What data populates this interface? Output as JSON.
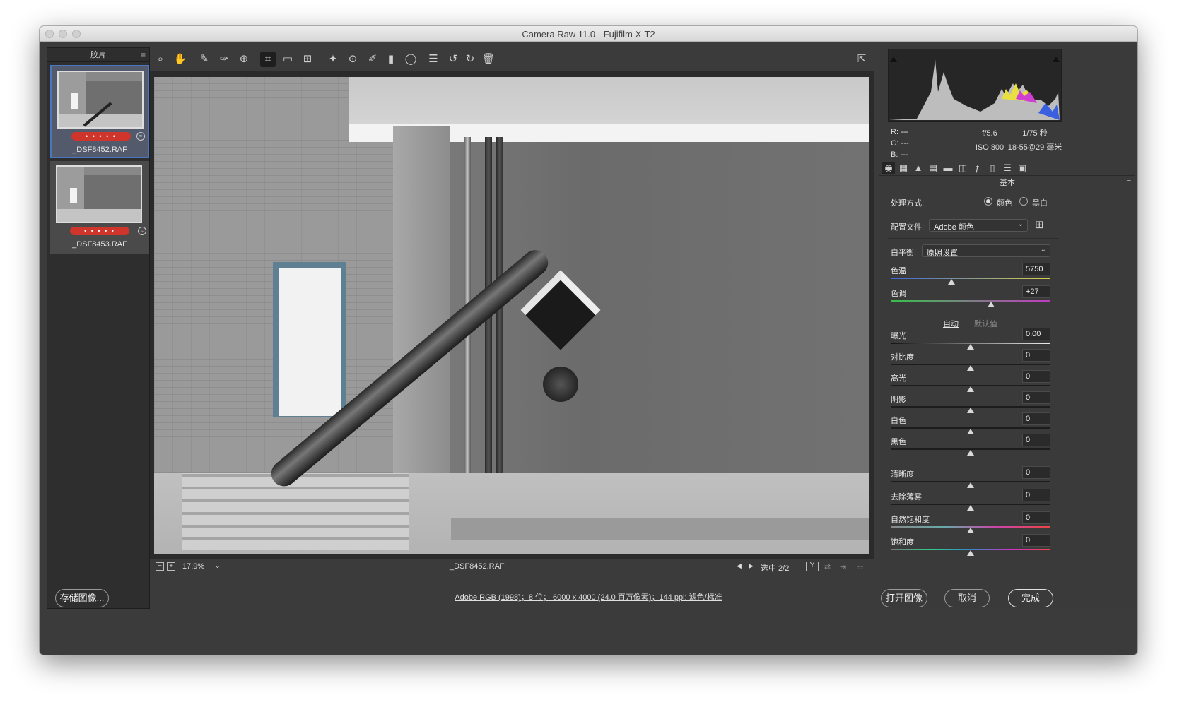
{
  "window": {
    "title": "Camera Raw 11.0 -  Fujifilm X-T2"
  },
  "filmstrip": {
    "title": "胶片",
    "items": [
      {
        "name": "_DSF8452.RAF",
        "rating": "• • • • •",
        "selected": true
      },
      {
        "name": "_DSF8453.RAF",
        "rating": "• • • • •",
        "selected": false
      }
    ]
  },
  "toolbar": {
    "tools": [
      "zoom-icon",
      "hand-icon",
      "white-balance-icon",
      "color-sampler-icon",
      "targeted-adjustment-icon",
      "crop-icon",
      "straighten-icon",
      "transform-icon",
      "spot-removal-icon",
      "red-eye-icon",
      "adjustment-brush-icon",
      "graduated-filter-icon",
      "radial-filter-icon",
      "list-icon",
      "rotate-left-icon",
      "rotate-right-icon",
      "trash-icon"
    ],
    "fullscreen_icon": "fullscreen-icon"
  },
  "statusbar": {
    "zoom": "17.9%",
    "filename": "_DSF8452.RAF",
    "selection": "选中 2/2",
    "y_label": "Y"
  },
  "panel": {
    "histogram": {
      "r": "R:   ---",
      "g": "G:   ---",
      "b": "B:   ---"
    },
    "exif": {
      "aperture": "f/5.6",
      "shutter": "1/75 秒",
      "iso": "ISO 800",
      "lens": "18-55@29 毫米"
    },
    "section_title": "基本",
    "treatment_label": "处理方式:",
    "treatment_color": "颜色",
    "treatment_bw": "黑白",
    "profile_label": "配置文件:",
    "profile_value": "Adobe 颜色",
    "wb_label": "白平衡:",
    "wb_value": "原照设置",
    "auto": "自动",
    "default": "默认值",
    "sliders": [
      {
        "label": "色温",
        "value": "5750",
        "level": 0.38
      },
      {
        "label": "色调",
        "value": "+27",
        "level": 0.63
      },
      {
        "label": "曝光",
        "value": "0.00",
        "level": 0.5
      },
      {
        "label": "对比度",
        "value": "0",
        "level": 0.5
      },
      {
        "label": "高光",
        "value": "0",
        "level": 0.5
      },
      {
        "label": "阴影",
        "value": "0",
        "level": 0.5
      },
      {
        "label": "白色",
        "value": "0",
        "level": 0.5
      },
      {
        "label": "黑色",
        "value": "0",
        "level": 0.5
      },
      {
        "label": "清晰度",
        "value": "0",
        "level": 0.5
      },
      {
        "label": "去除薄雾",
        "value": "0",
        "level": 0.5
      },
      {
        "label": "自然饱和度",
        "value": "0",
        "level": 0.5
      },
      {
        "label": "饱和度",
        "value": "0",
        "level": 0.5
      }
    ]
  },
  "bottom": {
    "save": "存储图像...",
    "info": "Adobe RGB (1998)；8 位；  6000 x 4000 (24.0 百万像素)；144 ppi; 滤色/标准",
    "open": "打开图像",
    "cancel": "取消",
    "done": "完成"
  }
}
